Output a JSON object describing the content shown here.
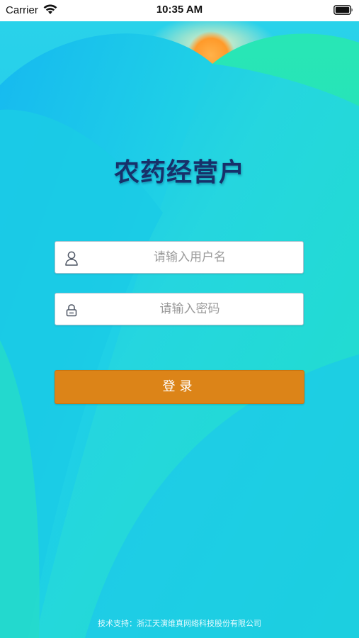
{
  "status_bar": {
    "carrier": "Carrier",
    "time": "10:35 AM"
  },
  "app": {
    "title": "农药经营户"
  },
  "login_form": {
    "username_placeholder": "请输入用户名",
    "password_placeholder": "请输入密码",
    "submit_label": "登录"
  },
  "footer": {
    "text": "技术支持：浙江天演维真网络科技股份有限公司"
  },
  "icons": {
    "username": "user-icon",
    "password": "lock-icon",
    "wifi": "wifi-icon",
    "battery": "battery-icon"
  },
  "colors": {
    "title": "#17316a",
    "button": "#dc8418",
    "background_top": "#21c3f2",
    "background_green": "#1fe0b9"
  }
}
